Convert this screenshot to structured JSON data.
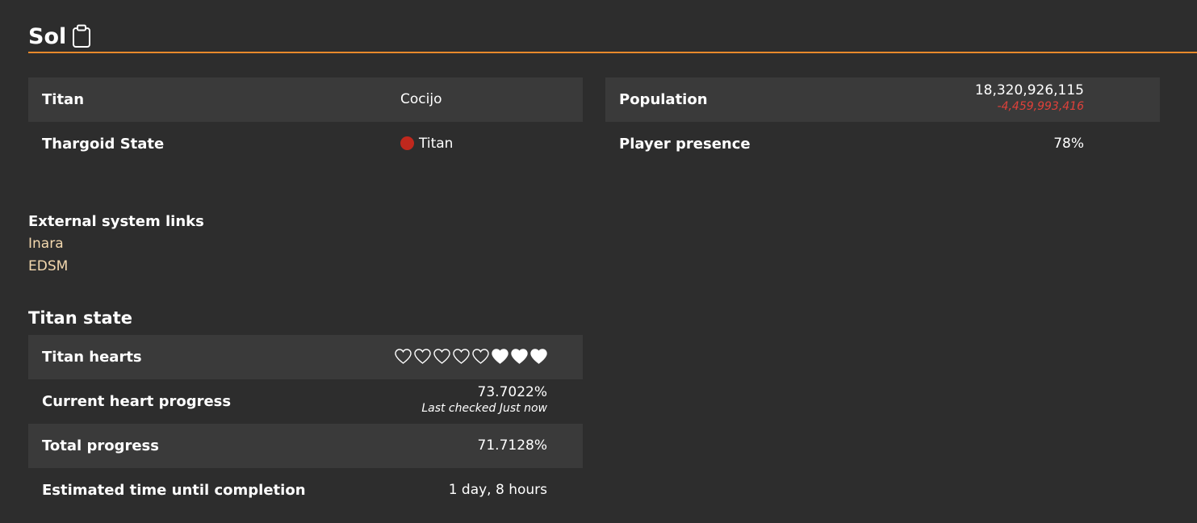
{
  "system": {
    "name": "Sol",
    "copy_icon": "clipboard-icon"
  },
  "left_table": {
    "titan_label": "Titan",
    "titan_value": "Cocijo",
    "thargoid_state_label": "Thargoid State",
    "thargoid_state_value": "Titan",
    "thargoid_state_color": "#c0281d"
  },
  "right_table": {
    "population_label": "Population",
    "population_value": "18,320,926,115",
    "population_change": "-4,459,993,416",
    "population_change_color": "#e0413a",
    "player_presence_label": "Player presence",
    "player_presence_value": "78%"
  },
  "external_links": {
    "heading": "External system links",
    "links": [
      "Inara",
      "EDSM"
    ],
    "link_color": "#f3d8ae"
  },
  "titan_state": {
    "heading": "Titan state",
    "hearts_label": "Titan hearts",
    "hearts_total": 8,
    "hearts_empty": 5,
    "hearts_filled": 3,
    "current_heart_progress_label": "Current heart progress",
    "current_heart_progress_value": "73.7022%",
    "last_checked": "Last checked Just now",
    "total_progress_label": "Total progress",
    "total_progress_value": "71.7128%",
    "eta_label": "Estimated time until completion",
    "eta_value": "1 day, 8 hours"
  },
  "colors": {
    "background": "#2d2d2d",
    "row_shade": "#3a3a3a",
    "accent": "#e8892b"
  }
}
